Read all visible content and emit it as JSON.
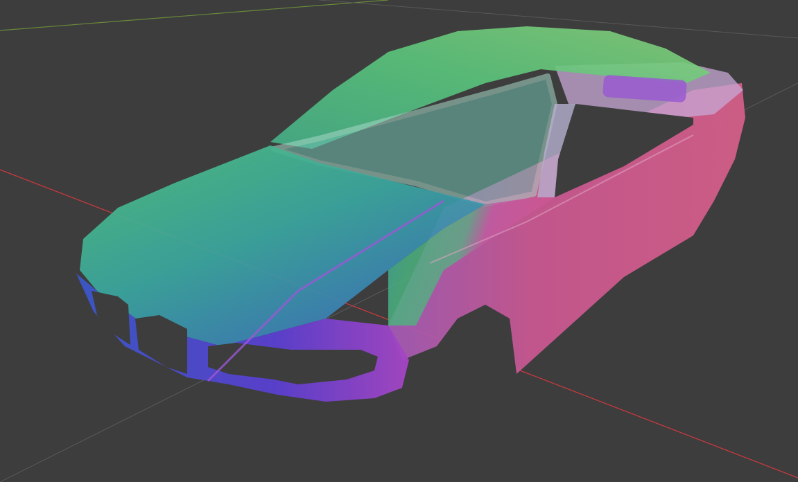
{
  "viewport": {
    "background": "#3d3d3d",
    "axes": {
      "x_axis_color": "#c8393f",
      "y_axis_color": "#6a8a3a",
      "grid_color": "#5a5a5a"
    },
    "object": {
      "type": "car-body-mesh",
      "shading": "normal-map",
      "palette": {
        "green": "#55c978",
        "cyan": "#3aa6a0",
        "blue": "#3b4fc4",
        "purple": "#9b3fd0",
        "pink": "#d0568f"
      }
    }
  }
}
